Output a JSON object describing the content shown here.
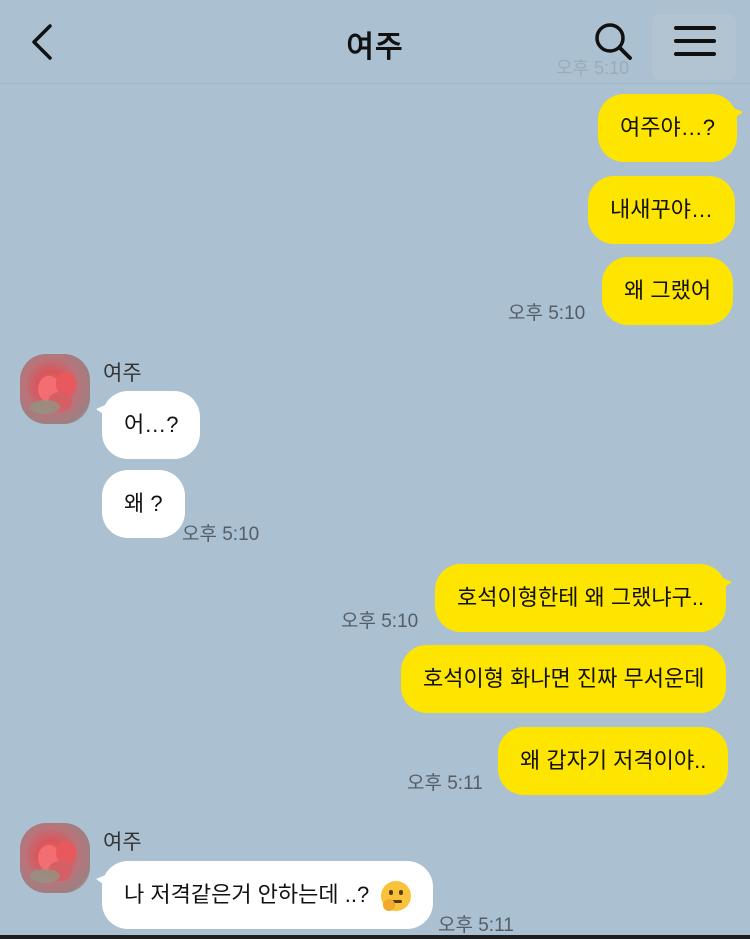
{
  "header": {
    "title": "여주",
    "back_icon": "chevron-left-icon",
    "search_icon": "search-icon",
    "menu_icon": "hamburger-menu-icon",
    "ghost_time": "오후 5:10"
  },
  "colors": {
    "background": "#abc1d1",
    "my_bubble": "#fee500",
    "other_bubble": "#ffffff"
  },
  "messages": [
    {
      "text": "여주야…?"
    },
    {
      "text": "내새꾸야…"
    },
    {
      "text": "왜 그랬어",
      "time": "오후 5:10"
    },
    {
      "sender": "여주",
      "text": "어…?"
    },
    {
      "text": "왜 ?",
      "time": "오후 5:10"
    },
    {
      "text": "호석이형한테 왜 그랬냐구..",
      "time": "오후 5:10"
    },
    {
      "text": "호석이형 화나면 진짜 무서운데"
    },
    {
      "text": "왜 갑자기 저격이야..",
      "time": "오후 5:11"
    },
    {
      "sender": "여주",
      "text": "나 저격같은거 안하는데 ..?",
      "emoji": "thinking-face-emoji",
      "time": "오후 5:11"
    }
  ]
}
